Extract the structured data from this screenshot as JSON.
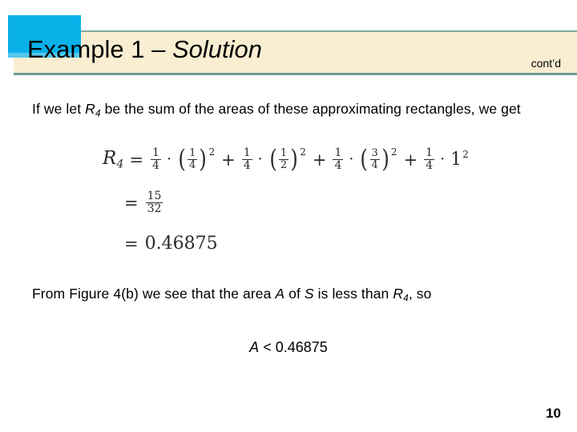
{
  "slide": {
    "header": {
      "title_plain": "Example 1 – ",
      "title_italic": "Solution",
      "continued_label": "cont’d",
      "band_color": "#faeed2",
      "accent_square_color": "#0ab0e8",
      "rule_color": "#6f9c96"
    },
    "body": {
      "paragraph_top_part1": "If we let ",
      "paragraph_top_var": "R",
      "paragraph_top_var_sub": "4",
      "paragraph_top_part2": " be the sum of the areas of these approximating rectangles, we get",
      "paragraph_bottom_part1": "From Figure 4(b) we see that the area ",
      "paragraph_bottom_var_a": "A",
      "paragraph_bottom_part2": " of ",
      "paragraph_bottom_var_s": "S",
      "paragraph_bottom_part3": " is less than ",
      "paragraph_bottom_var_r": "R",
      "paragraph_bottom_var_r_sub": "4",
      "paragraph_bottom_part4": ", so"
    },
    "math": {
      "line1": {
        "label": "R",
        "label_sub": "4",
        "equals": "=",
        "terms": [
          {
            "coefficient_num": "1",
            "coefficient_den": "4",
            "dot": "·",
            "base_num": "1",
            "base_den": "4",
            "exponent": "2"
          },
          {
            "coefficient_num": "1",
            "coefficient_den": "4",
            "dot": "·",
            "base_num": "1",
            "base_den": "2",
            "exponent": "2"
          },
          {
            "coefficient_num": "1",
            "coefficient_den": "4",
            "dot": "·",
            "base_num": "3",
            "base_den": "4",
            "exponent": "2"
          }
        ],
        "plus": "+",
        "last_coefficient_num": "1",
        "last_coefficient_den": "4",
        "last_dot": "·",
        "last_base": "1",
        "last_exponent": "2"
      },
      "line2": {
        "equals": "=",
        "num": "15",
        "den": "32"
      },
      "line3": {
        "equals": "=",
        "value": "0.46875"
      }
    },
    "inequality": {
      "variable": "A",
      "operator": "<",
      "value": "0.46875"
    },
    "page_number": "10"
  }
}
